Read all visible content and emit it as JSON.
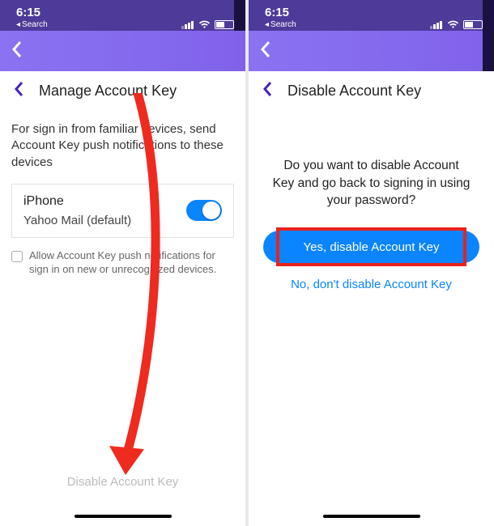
{
  "statusbar": {
    "time": "6:15",
    "breadcrumb_chevron": "◂",
    "breadcrumb_label": "Search"
  },
  "left": {
    "page_title": "Manage Account Key",
    "intro": "For sign in from familiar devices, send Account Key push notifications to these devices",
    "device": {
      "name": "iPhone",
      "app": "Yahoo Mail (default)"
    },
    "allow_label": "Allow Account Key push notifications for sign in on new or unrecognized devices.",
    "disable_link": "Disable Account Key"
  },
  "right": {
    "page_title": "Disable Account Key",
    "question": "Do you want to disable Account Key and go back to signing in using your password?",
    "yes_label": "Yes, disable Account Key",
    "no_label": "No, don't disable Account Key"
  }
}
